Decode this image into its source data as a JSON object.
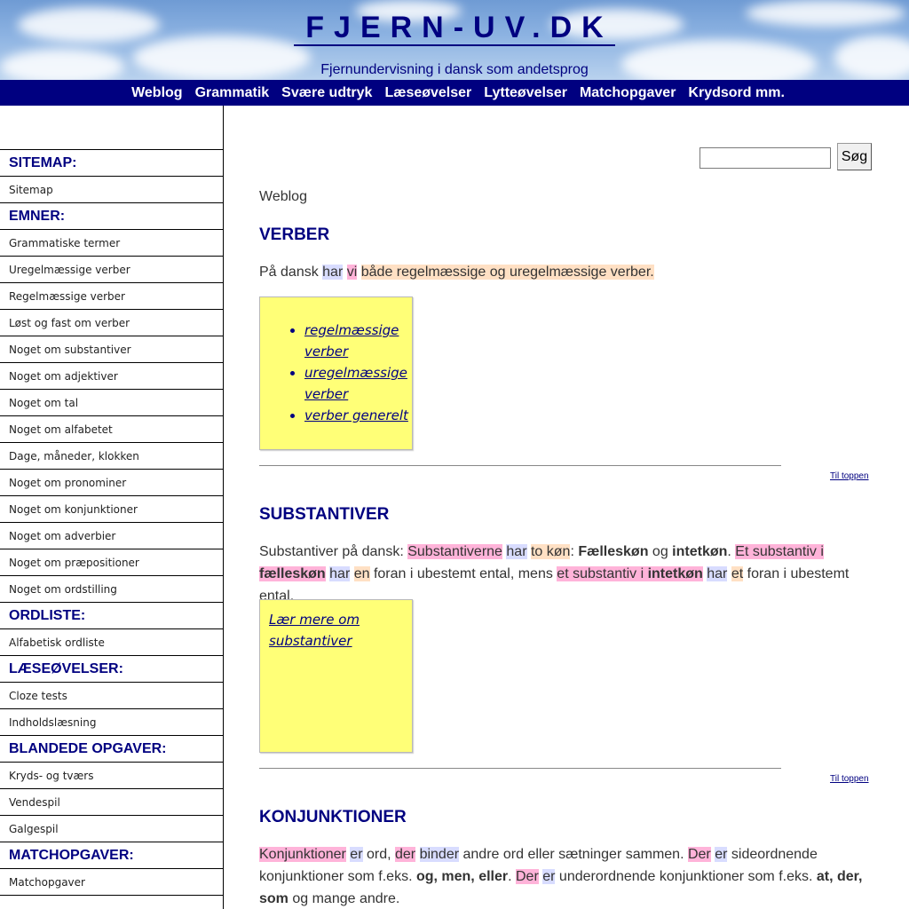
{
  "header": {
    "title": "FJERN-UV.DK",
    "subtitle": "Fjernundervisning i dansk som andetsprog"
  },
  "topnav": [
    "Weblog",
    "Grammatik",
    "Svære udtryk",
    "Læseøvelser",
    "Lytteøvelser",
    "Matchopgaver",
    "Krydsord mm."
  ],
  "sidebar": {
    "rows": [
      {
        "type": "header",
        "label": "SITEMAP:"
      },
      {
        "type": "link",
        "label": "Sitemap"
      },
      {
        "type": "header",
        "label": "EMNER:"
      },
      {
        "type": "link",
        "label": "Grammatiske termer"
      },
      {
        "type": "link",
        "label": "Uregelmæssige verber"
      },
      {
        "type": "link",
        "label": "Regelmæssige verber"
      },
      {
        "type": "link",
        "label": "Løst og fast om verber"
      },
      {
        "type": "link",
        "label": "Noget om substantiver"
      },
      {
        "type": "link",
        "label": "Noget om adjektiver"
      },
      {
        "type": "link",
        "label": "Noget om tal"
      },
      {
        "type": "link",
        "label": "Noget om alfabetet"
      },
      {
        "type": "link",
        "label": "Dage, måneder, klokken"
      },
      {
        "type": "link",
        "label": "Noget om pronominer"
      },
      {
        "type": "link",
        "label": "Noget om konjunktioner"
      },
      {
        "type": "link",
        "label": "Noget om adverbier"
      },
      {
        "type": "link",
        "label": "Noget om præpositioner"
      },
      {
        "type": "link",
        "label": "Noget om ordstilling"
      },
      {
        "type": "header",
        "label": "ORDLISTE:"
      },
      {
        "type": "link",
        "label": "Alfabetisk ordliste"
      },
      {
        "type": "header",
        "label": "LÆSEØVELSER:"
      },
      {
        "type": "link",
        "label": "Cloze tests"
      },
      {
        "type": "link",
        "label": "Indholdslæsning"
      },
      {
        "type": "header",
        "label": "BLANDEDE OPGAVER:"
      },
      {
        "type": "link",
        "label": "Kryds- og tværs"
      },
      {
        "type": "link",
        "label": "Vendespil"
      },
      {
        "type": "link",
        "label": "Galgespil"
      },
      {
        "type": "header",
        "label": "MATCHOPGAVER:"
      },
      {
        "type": "link",
        "label": "Matchopgaver"
      }
    ]
  },
  "search": {
    "button_label": "Søg",
    "value": ""
  },
  "breadcrumb": "Weblog",
  "sections": {
    "verber": {
      "title": "VERBER",
      "links": [
        "regelmæssige verber",
        "uregelmæssige verber",
        "verber generelt"
      ]
    },
    "substantiver": {
      "title": "SUBSTANTIVER",
      "link": "Lær mere om substantiver"
    },
    "konjunktioner": {
      "title": "KONJUNKTIONER"
    }
  },
  "to_top_label": "Til toppen",
  "colors": {
    "navy": "#000080",
    "note_yellow": "#ffff77",
    "hl_blue": "#d8dcff",
    "hl_orange": "#ffe0c4",
    "hl_pink": "#ffb3d9"
  }
}
